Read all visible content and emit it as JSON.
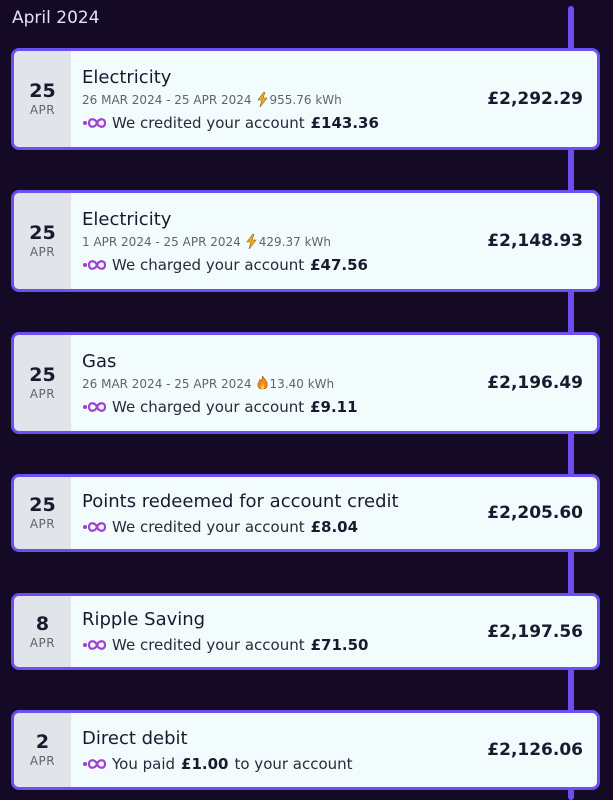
{
  "month_header": "April 2024",
  "colors": {
    "background": "#140a26",
    "accent": "#6b4ff2",
    "card": "#f2fcfd"
  },
  "transactions": [
    {
      "day": "25",
      "month": "APR",
      "title": "Electricity",
      "period": "26 MAR 2024 - 25 APR 2024",
      "usage_icon": "lightning-icon",
      "usage": "955.76 kWh",
      "note_prefix": "We credited your account",
      "note_amount": "£143.36",
      "note_suffix": "",
      "balance": "£2,292.29"
    },
    {
      "day": "25",
      "month": "APR",
      "title": "Electricity",
      "period": "1 APR 2024 - 25 APR 2024",
      "usage_icon": "lightning-icon",
      "usage": "429.37 kWh",
      "note_prefix": "We charged your account",
      "note_amount": "£47.56",
      "note_suffix": "",
      "balance": "£2,148.93"
    },
    {
      "day": "25",
      "month": "APR",
      "title": "Gas",
      "period": "26 MAR 2024 - 25 APR 2024",
      "usage_icon": "flame-icon",
      "usage": "13.40 kWh",
      "note_prefix": "We charged your account",
      "note_amount": "£9.11",
      "note_suffix": "",
      "balance": "£2,196.49"
    },
    {
      "day": "25",
      "month": "APR",
      "title": "Points redeemed for account credit",
      "note_prefix": "We credited your account",
      "note_amount": "£8.04",
      "note_suffix": "",
      "balance": "£2,205.60"
    },
    {
      "day": "8",
      "month": "APR",
      "title": "Ripple Saving",
      "note_prefix": "We credited your account",
      "note_amount": "£71.50",
      "note_suffix": "",
      "balance": "£2,197.56"
    },
    {
      "day": "2",
      "month": "APR",
      "title": "Direct debit",
      "note_prefix": "You paid",
      "note_amount": "£1.00",
      "note_suffix": "to your account",
      "balance": "£2,126.06"
    }
  ]
}
